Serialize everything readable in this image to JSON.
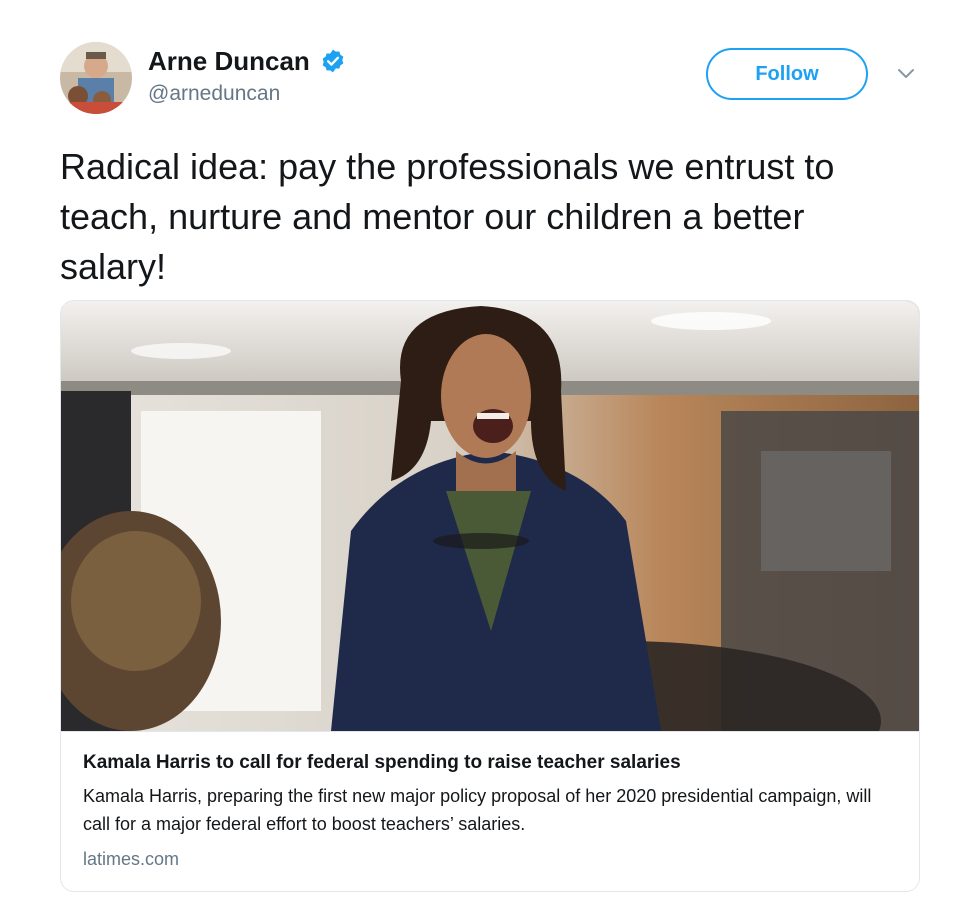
{
  "author": {
    "display_name": "Arne Duncan",
    "handle": "@arneduncan",
    "verified_icon": "verified-badge-icon",
    "verified_color": "#1da1f2"
  },
  "actions": {
    "follow_label": "Follow",
    "more_icon": "chevron-down-icon"
  },
  "tweet": {
    "text": "Radical idea: pay the professionals we entrust to teach, nurture and mentor our children a better salary!"
  },
  "card": {
    "title": "Kamala Harris to call for federal spending to raise teacher salaries",
    "description": "Kamala Harris, preparing the first new major policy proposal of her 2020 presidential campaign, will call for a major federal effort to boost teachers’ salaries.",
    "domain": "latimes.com"
  },
  "colors": {
    "accent": "#1da1f2",
    "text": "#14171a",
    "muted": "#657786",
    "border": "#e1e8ed"
  }
}
